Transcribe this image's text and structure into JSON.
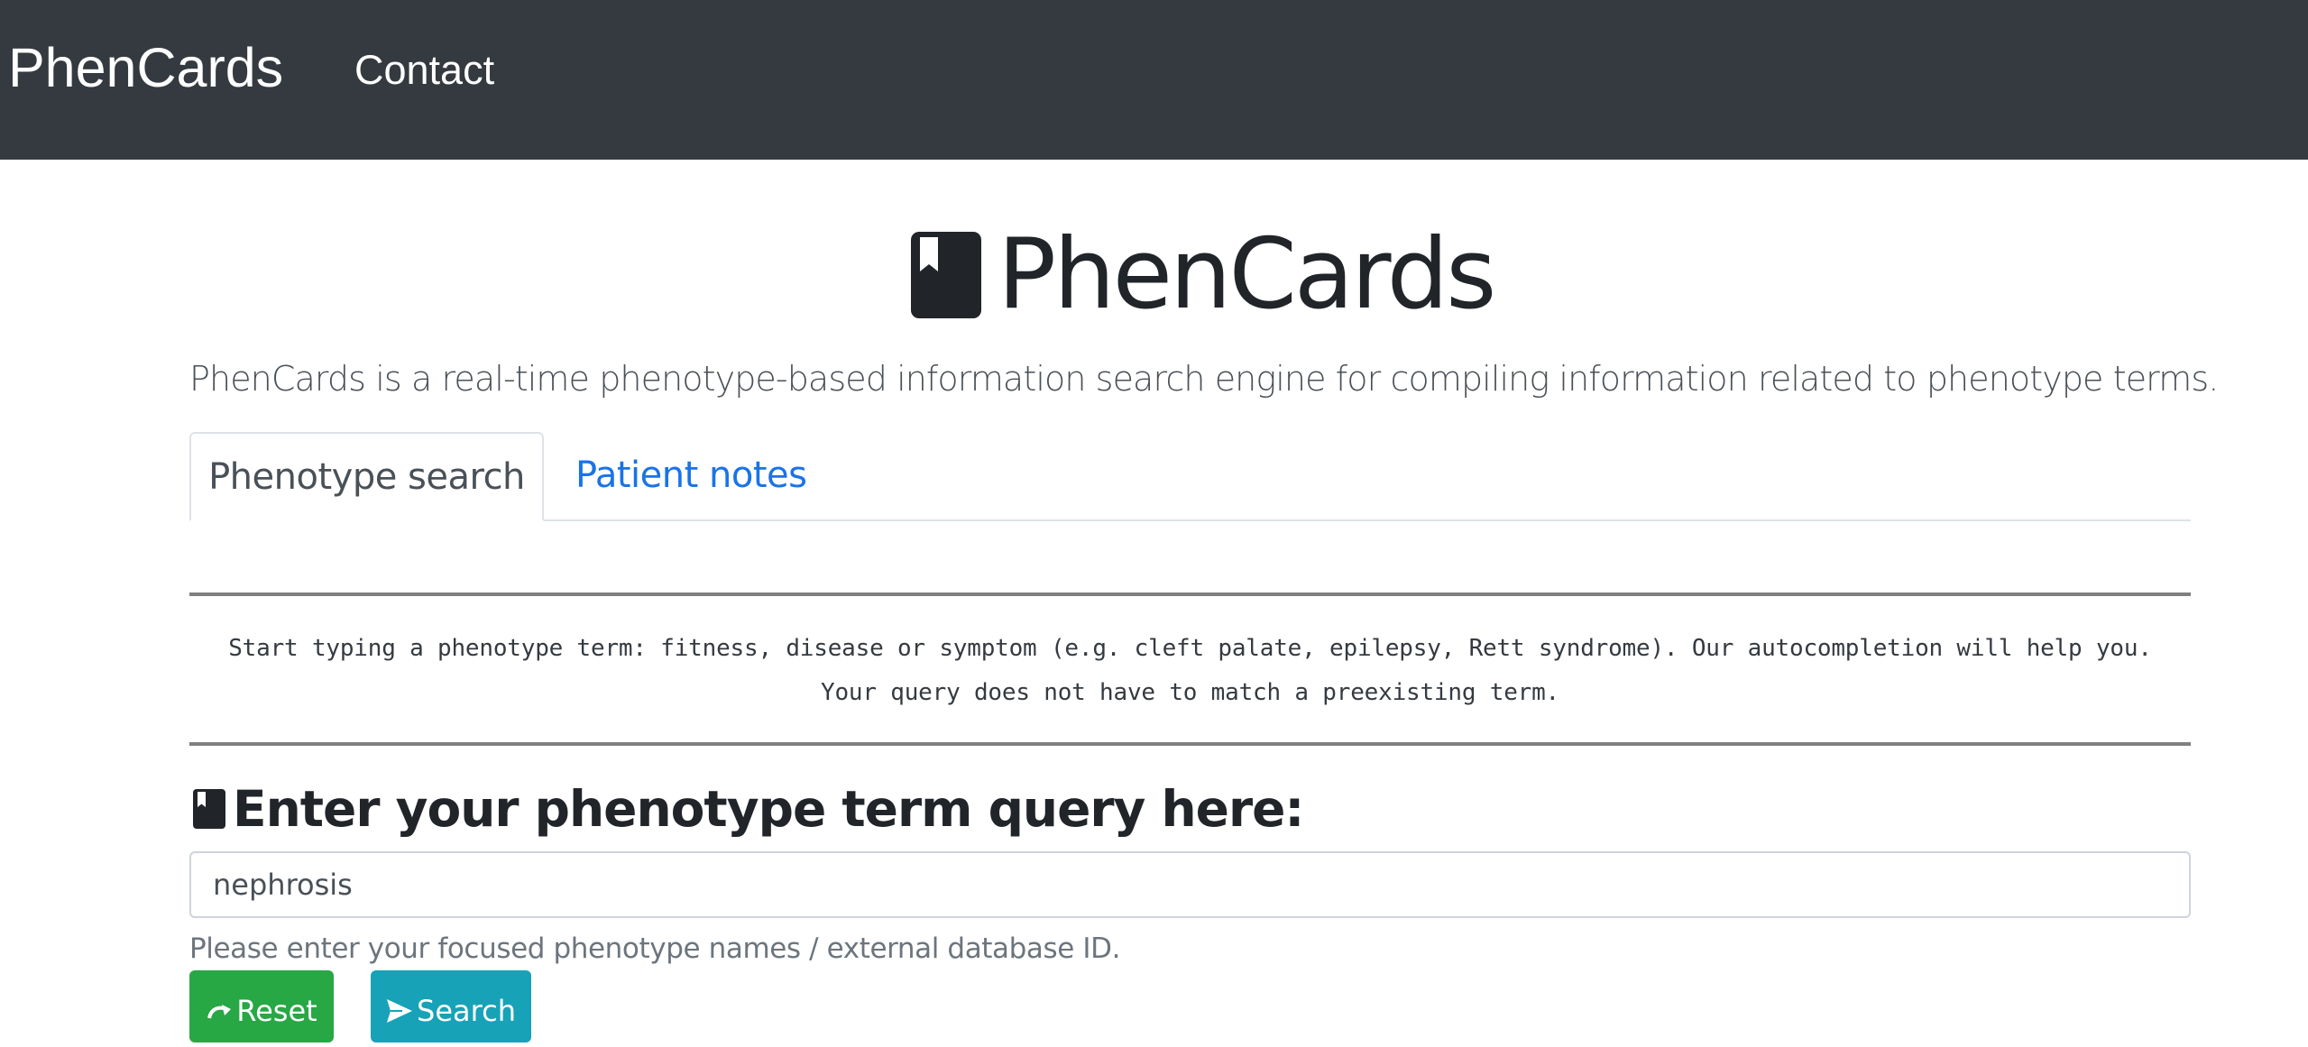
{
  "navbar": {
    "brand": "PhenCards",
    "contact": "Contact"
  },
  "hero": {
    "title": "PhenCards",
    "icon": "bookmark-book-icon"
  },
  "lead": "PhenCards is a real-time phenotype-based information search engine for compiling information related to phenotype terms.",
  "tabs": [
    {
      "label": "Phenotype search",
      "active": true
    },
    {
      "label": "Patient notes",
      "active": false
    }
  ],
  "help": {
    "line1": "Start typing a phenotype term: fitness, disease or symptom (e.g. cleft palate, epilepsy, Rett syndrome). Our autocompletion will help you.",
    "line2": "Your query does not have to match a preexisting term."
  },
  "query": {
    "heading": "Enter your phenotype term query here:",
    "value": "nephrosis",
    "help": "Please enter your focused phenotype names / external database ID."
  },
  "buttons": {
    "reset": "Reset",
    "reset_icon": "redo-arrow-icon",
    "search": "Search",
    "search_icon": "send-arrow-icon"
  },
  "colors": {
    "navbar_bg": "#343a40",
    "link": "#1a73e8",
    "reset_bg": "#28a745",
    "search_bg": "#17a2b8"
  }
}
